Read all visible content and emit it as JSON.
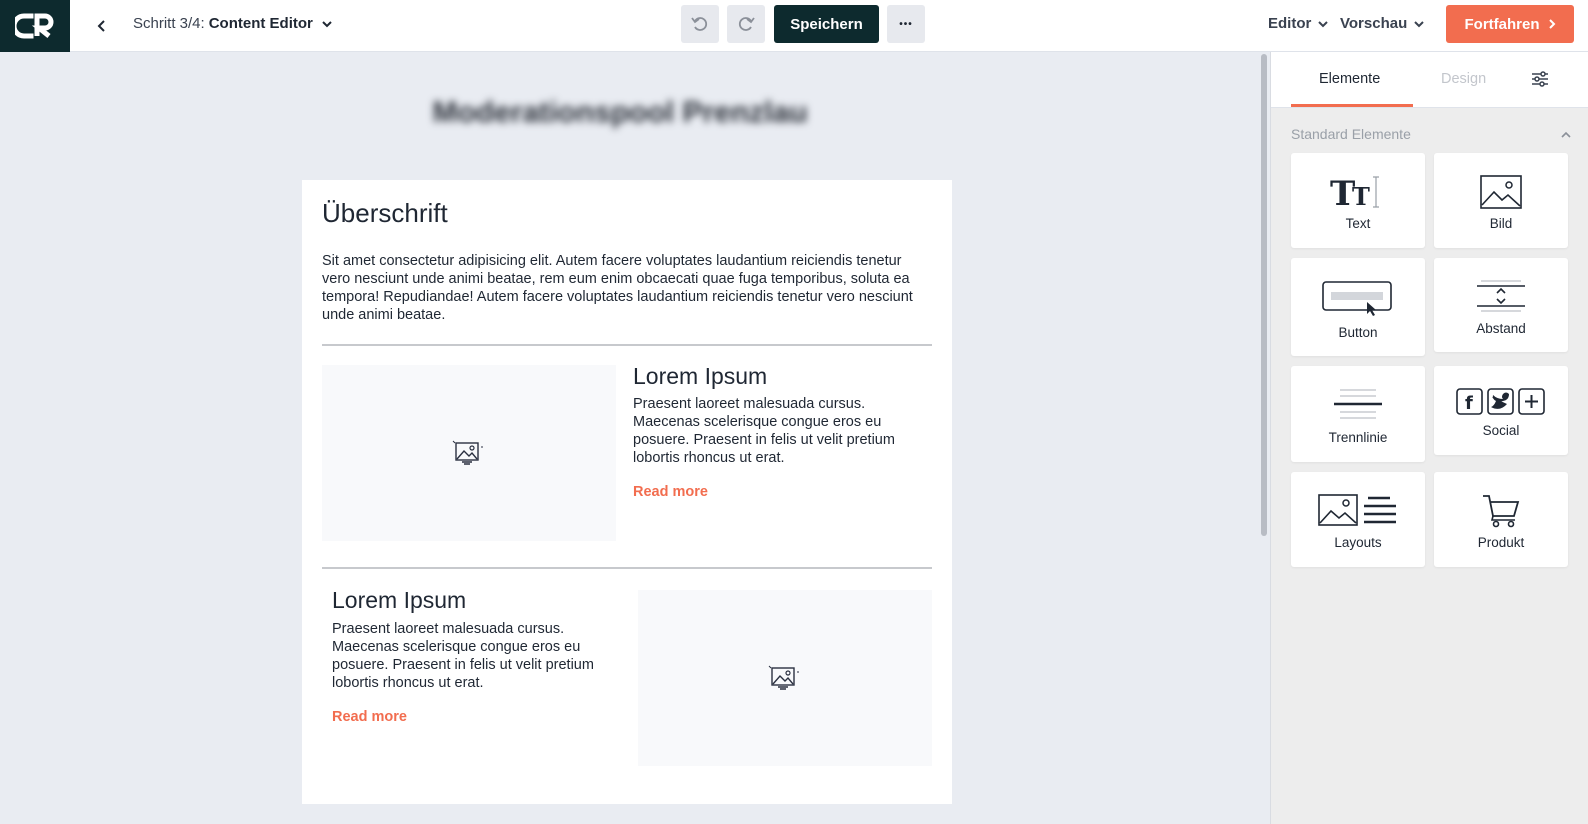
{
  "header": {
    "step_prefix": "Schritt 3/4:",
    "step_title": "Content Editor",
    "save_label": "Speichern",
    "editor_label": "Editor",
    "preview_label": "Vorschau",
    "continue_label": "Fortfahren",
    "more_label": "•••"
  },
  "canvas": {
    "blurred_title": "Moderationspool Prenzlau",
    "heading": "Überschrift",
    "intro": "Sit amet consectetur adipisicing elit. Autem facere voluptates laudantium reiciendis tenetur vero nesciunt unde animi beatae, rem eum enim obcaecati quae fuga temporibus, soluta ea tempora! Repudiandae! Autem facere voluptates laudantium reiciendis tenetur vero nesciunt unde animi beatae.",
    "articles": [
      {
        "title": "Lorem Ipsum",
        "text": "Praesent laoreet malesuada cursus. Maecenas scelerisque congue eros eu posuere. Praesent in felis ut velit pretium lobortis rhoncus ut erat.",
        "link": "Read more"
      },
      {
        "title": "Lorem Ipsum",
        "text": "Praesent laoreet malesuada cursus. Maecenas scelerisque congue eros eu posuere. Praesent in felis ut velit pretium lobortis rhoncus ut erat.",
        "link": "Read more"
      }
    ]
  },
  "sidebar": {
    "tabs": [
      "Elemente",
      "Design"
    ],
    "section_title": "Standard Elemente",
    "elements": [
      "Text",
      "Bild",
      "Button",
      "Abstand",
      "Trennlinie",
      "Social",
      "Layouts",
      "Produkt"
    ]
  },
  "colors": {
    "accent": "#f26d4f",
    "dark": "#0d2a2e",
    "canvas_bg": "#e9ecf2"
  },
  "icons": [
    "logo-icon",
    "chevron-left-icon",
    "chevron-down-icon",
    "undo-icon",
    "redo-icon",
    "chevron-right-icon",
    "image-placeholder-icon",
    "settings-sliders-icon",
    "chevron-up-icon"
  ]
}
